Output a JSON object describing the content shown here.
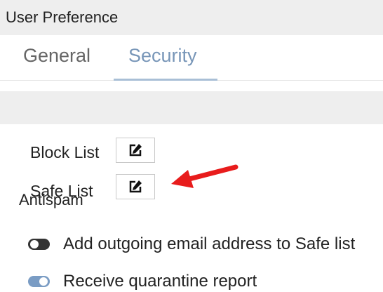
{
  "header": {
    "title": "User Preference"
  },
  "tabs": [
    {
      "label": "General",
      "active": false
    },
    {
      "label": "Security",
      "active": true
    }
  ],
  "section": {
    "title": "Antispam"
  },
  "lists": [
    {
      "label": "Block List",
      "icon": "edit-icon"
    },
    {
      "label": "Safe List",
      "icon": "edit-icon"
    }
  ],
  "options": [
    {
      "label": "Add outgoing email address to Safe list",
      "enabled": false
    },
    {
      "label": "Receive quarantine report",
      "enabled": true
    }
  ],
  "annotation": {
    "icon": "red-arrow",
    "color": "#e81c1c",
    "points_to": "Safe List"
  },
  "colors": {
    "header_bg": "#eeeeee",
    "active_tab": "#7896b8",
    "toggle_on": "#7a9cc4",
    "toggle_off": "#333333"
  }
}
